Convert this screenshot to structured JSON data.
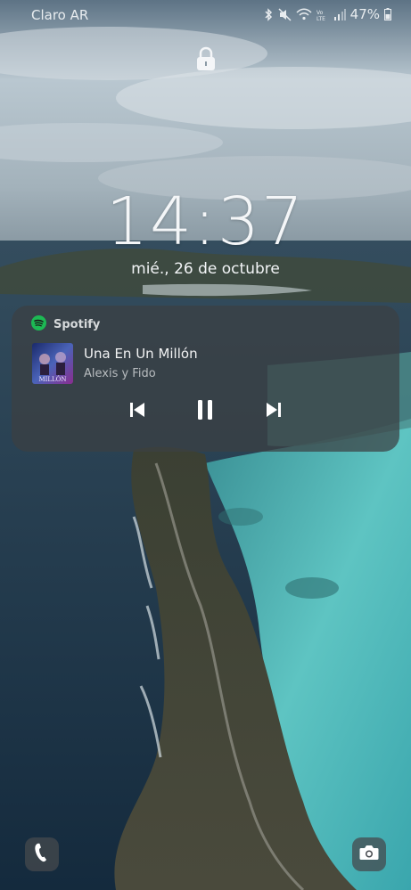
{
  "status_bar": {
    "carrier": "Claro AR",
    "battery_percent": "47%",
    "icons": [
      "bluetooth-icon",
      "mute-icon",
      "wifi-icon",
      "volte-icon",
      "signal-icon",
      "battery-icon"
    ]
  },
  "lockscreen": {
    "lock_icon": "lock-icon",
    "time": "14:37",
    "date": "mié., 26 de octubre"
  },
  "media": {
    "app_name": "Spotify",
    "app_icon": "spotify-icon",
    "track_title": "Una En Un Millón",
    "artist": "Alexis y Fido",
    "album_art_text": "MILLÓN",
    "controls": [
      "previous-icon",
      "pause-icon",
      "next-icon"
    ]
  },
  "shortcuts": {
    "left": "phone-icon",
    "right": "camera-icon"
  },
  "colors": {
    "spotify_green": "#1DB954",
    "card_bg": "#3c4042",
    "sea_turquoise": "#4fb3b4",
    "ocean_dark": "#1d3344"
  }
}
